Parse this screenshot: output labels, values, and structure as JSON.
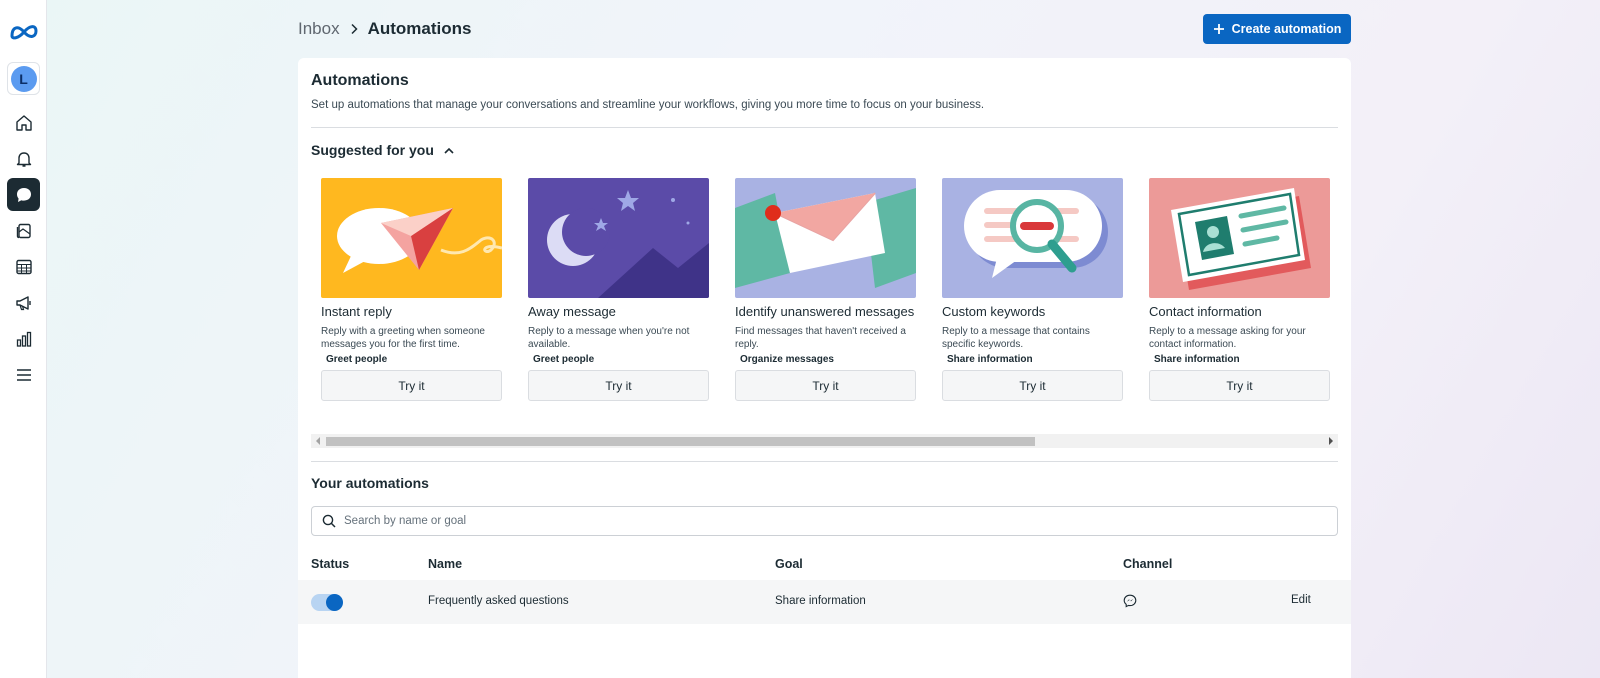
{
  "colors": {
    "accent": "#0a66c2",
    "rail_active": "#1c2b33",
    "text": "#1c2b33"
  },
  "rail": {
    "logo": "meta-logo",
    "avatar_initial": "L",
    "items": [
      "home-icon",
      "notifications-bell-icon",
      "inbox-chat-icon",
      "content-pages-icon",
      "planner-table-icon",
      "ads-megaphone-icon",
      "insights-bar-chart-icon",
      "all-tools-menu-icon"
    ],
    "active_item": "inbox-chat-icon"
  },
  "breadcrumb": {
    "parent": "Inbox",
    "current": "Automations"
  },
  "header": {
    "create_label": "Create automation"
  },
  "panel": {
    "title": "Automations",
    "description": "Set up automations that manage your conversations and streamline your workflows, giving you more time to focus on your business."
  },
  "suggested": {
    "heading": "Suggested for you",
    "cards": [
      {
        "title": "Instant reply",
        "description": "Reply with a greeting when someone messages you for the first time.",
        "goal": "Greet people",
        "button": "Try it",
        "bg": "#ffb81f"
      },
      {
        "title": "Away message",
        "description": "Reply to a message when you're not available.",
        "goal": "Greet people",
        "button": "Try it",
        "bg": "#5b4ba8"
      },
      {
        "title": "Identify unanswered messages",
        "description": "Find messages that haven't received a reply.",
        "goal": "Organize messages",
        "button": "Try it",
        "bg": "#a9b2e3"
      },
      {
        "title": "Custom keywords",
        "description": "Reply to a message that contains specific keywords.",
        "goal": "Share information",
        "button": "Try it",
        "bg": "#a9b2e3"
      },
      {
        "title": "Contact information",
        "description": "Reply to a message asking for your contact information.",
        "goal": "Share information",
        "button": "Try it",
        "bg": "#ec9a98"
      }
    ]
  },
  "automations": {
    "heading": "Your automations",
    "search_placeholder": "Search by name or goal",
    "columns": {
      "status": "Status",
      "name": "Name",
      "goal": "Goal",
      "channel": "Channel"
    },
    "rows": [
      {
        "enabled": true,
        "name": "Frequently asked questions",
        "goal": "Share information",
        "channel_icon": "messenger-icon",
        "action": "Edit"
      }
    ]
  }
}
